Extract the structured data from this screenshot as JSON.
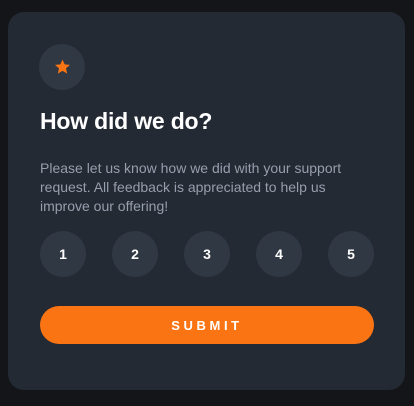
{
  "card": {
    "icon": "star-icon",
    "title": "How did we do?",
    "description": "Please let us know how we did with your support request. All feedback is appreciated to help us improve our offering!",
    "ratings": [
      "1",
      "2",
      "3",
      "4",
      "5"
    ],
    "submit_label": "SUBMIT"
  },
  "colors": {
    "background": "#131518",
    "card": "#232a34",
    "circle": "#2f3843",
    "accent": "#fb7413",
    "text_muted": "#969fac",
    "text": "#ffffff"
  }
}
